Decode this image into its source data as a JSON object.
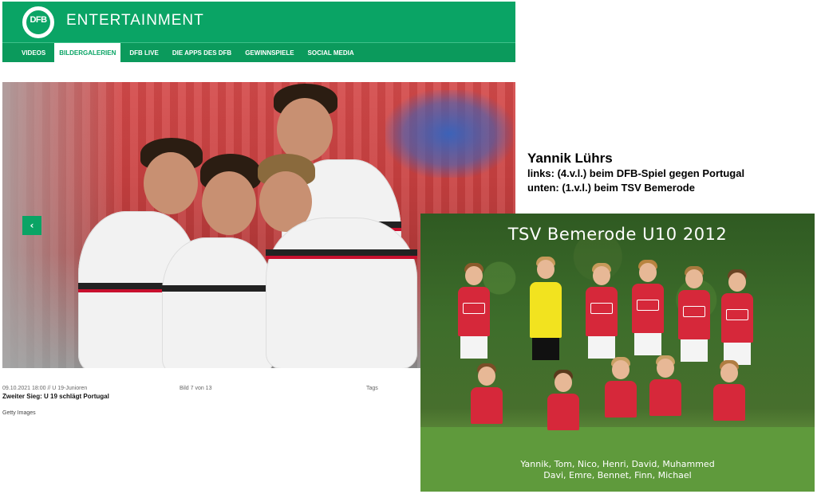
{
  "header": {
    "logo_text": "DFB",
    "title": "ENTERTAINMENT",
    "nav": [
      {
        "label": "VIDEOS",
        "active": false
      },
      {
        "label": "BILDERGALERIEN",
        "active": true
      },
      {
        "label": "DFB LIVE",
        "active": false
      },
      {
        "label": "DIE APPS DES DFB",
        "active": false
      },
      {
        "label": "GEWINNSPIELE",
        "active": false
      },
      {
        "label": "SOCIAL MEDIA",
        "active": false
      }
    ],
    "brand_color": "#0aa465"
  },
  "gallery": {
    "prev_icon": "chevron-left-icon",
    "date_line": "09.10.2021 18:00 // U 19-Junioren",
    "counter": "Bild 7 von 13",
    "tags_label": "Tags",
    "title": "Zweiter Sieg: U 19 schlägt Portugal",
    "credit": "Getty Images"
  },
  "annotation": {
    "name": "Yannik Lührs",
    "line1": "links: (4.v.l.) beim DFB-Spiel gegen Portugal",
    "line2": "unten: (1.v.l.) beim TSV Bemerode"
  },
  "team_photo": {
    "title": "TSV Bemerode U10 2012",
    "names_line1": "Yannik, Tom, Nico, Henri, David, Muhammed",
    "names_line2": "Davi, Emre, Bennet, Finn, Michael"
  }
}
